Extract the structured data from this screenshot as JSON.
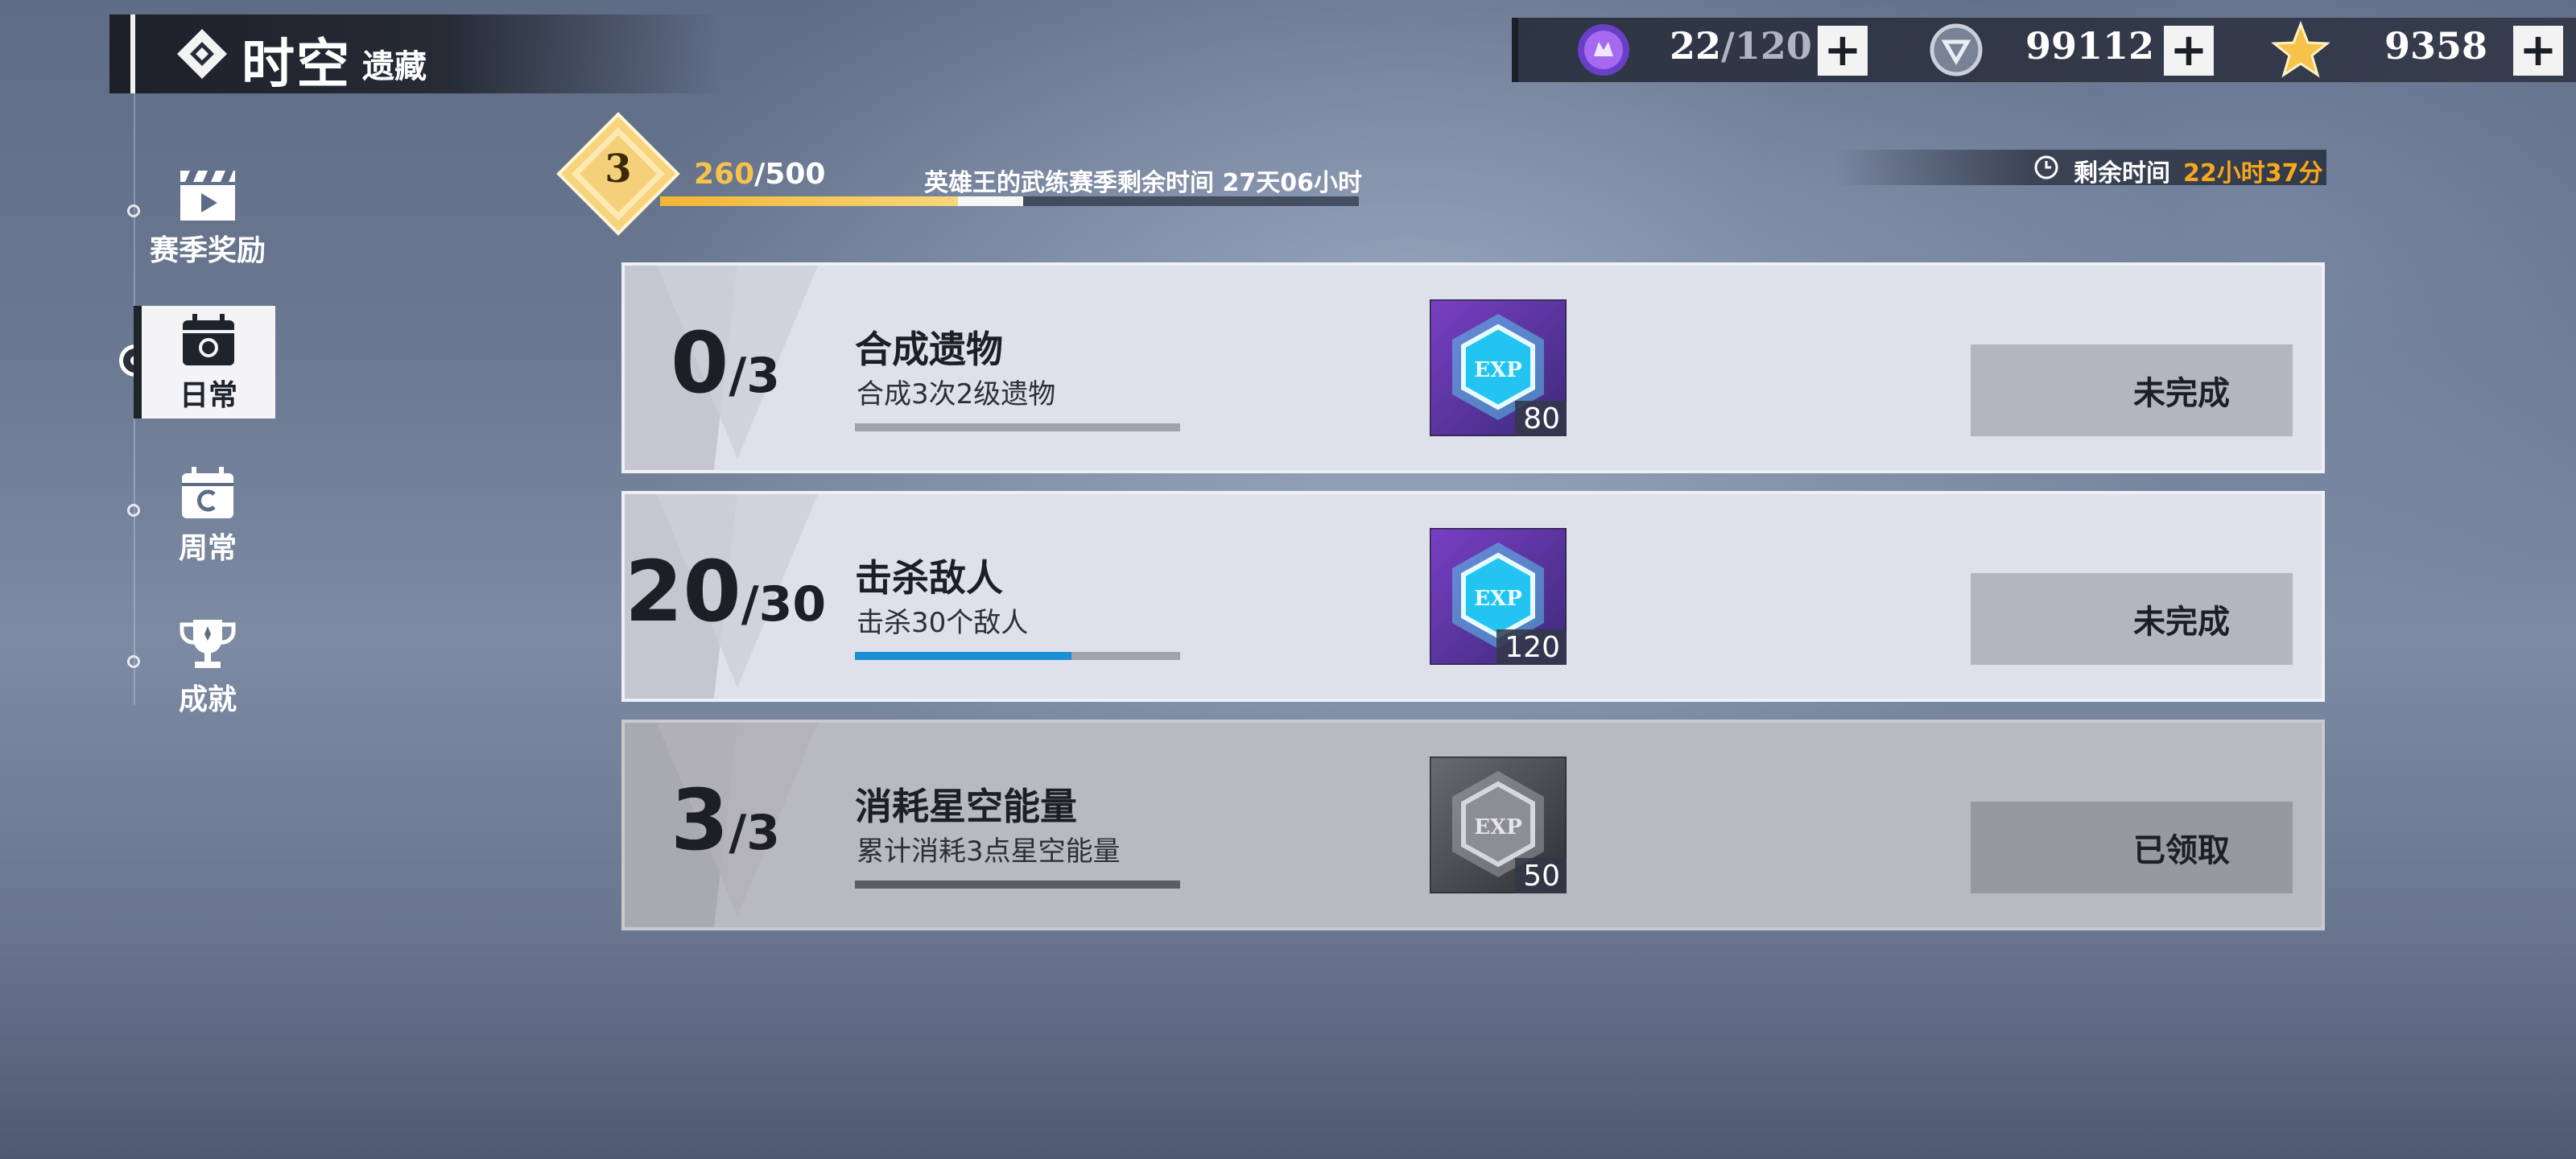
{
  "header": {
    "title_main": "时空",
    "title_sub": "遗藏"
  },
  "currencies": [
    {
      "icon": "purple-orb-icon",
      "value_current": "22",
      "value_sep": "/",
      "value_max": "120"
    },
    {
      "icon": "silver-coin-icon",
      "value": "99112"
    },
    {
      "icon": "gold-star-icon",
      "value": "9358"
    }
  ],
  "sidebar": {
    "items": [
      {
        "label": "赛季奖励",
        "icon": "clapperboard-icon",
        "active": false
      },
      {
        "label": "日常",
        "icon": "calendar-daily-icon",
        "active": true
      },
      {
        "label": "周常",
        "icon": "calendar-weekly-icon",
        "active": false
      },
      {
        "label": "成就",
        "icon": "trophy-icon",
        "active": false
      }
    ]
  },
  "level": {
    "value": "3",
    "xp_current": "260",
    "xp_rest": "/500",
    "xp_progress": 0.52
  },
  "season_text": "英雄王的武练赛季剩余时间 27天06小时",
  "timer": {
    "label": "剩余时间",
    "value": "22小时37分"
  },
  "tasks": [
    {
      "count_current": "0",
      "count_total": "/3",
      "title": "合成遗物",
      "desc": "合成3次2级遗物",
      "progress": 0.0,
      "reward_qty": "80",
      "reward_icon": "exp-crystal-icon",
      "status": "未完成",
      "done": false
    },
    {
      "count_current": "20",
      "count_total": "/30",
      "title": "击杀敌人",
      "desc": "击杀30个敌人",
      "progress": 0.6667,
      "reward_qty": "120",
      "reward_icon": "exp-crystal-icon",
      "status": "未完成",
      "done": false
    },
    {
      "count_current": "3",
      "count_total": "/3",
      "title": "消耗星空能量",
      "desc": "累计消耗3点星空能量",
      "progress": 1.0,
      "reward_qty": "50",
      "reward_icon": "exp-crystal-gray-icon",
      "status": "已领取",
      "done": true
    }
  ],
  "colors": {
    "accent_gold": "#f6c24a",
    "timer_orange": "#f6a81c",
    "progress_blue": "#1b8fd6"
  }
}
